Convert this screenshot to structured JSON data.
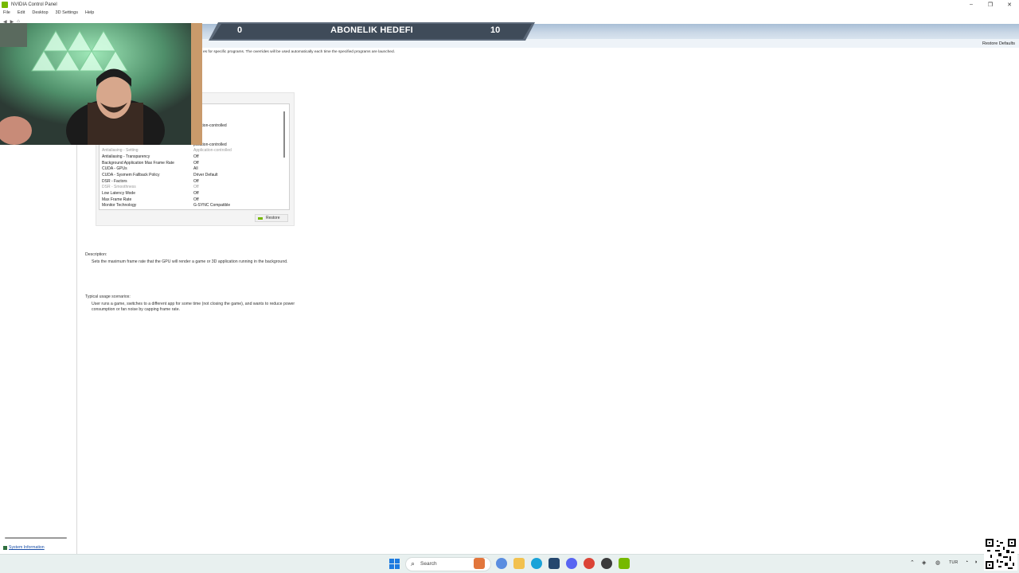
{
  "window": {
    "title": "NVIDIA Control Panel",
    "controls": [
      "–",
      "❐",
      "✕"
    ]
  },
  "menu": [
    "File",
    "Edit",
    "Desktop",
    "3D Settings",
    "Help"
  ],
  "toolbar_icons": [
    "back-icon",
    "forward-icon",
    "home-icon"
  ],
  "header": {
    "restore_defaults": "Restore Defaults"
  },
  "overlay_banner": {
    "left_value": "0",
    "title": "ABONELIK HEDEFI",
    "right_value": "10"
  },
  "content": {
    "intro": "es for specific programs. The overrides will be used automatically each time the specified programs are launched.",
    "settings_rows": [
      {
        "feature": "",
        "value": "d",
        "dim": false
      },
      {
        "feature": "",
        "value": "plication-controlled",
        "dim": false
      },
      {
        "feature": "",
        "value": "plication-controlled",
        "dim": false
      },
      {
        "feature": "Antialiasing - Setting",
        "value": "Application-controlled",
        "dim": true
      },
      {
        "feature": "Antialiasing - Transparency",
        "value": "Off",
        "dim": false
      },
      {
        "feature": "Background Application Max Frame Rate",
        "value": "Off",
        "dim": false
      },
      {
        "feature": "CUDA - GPUs",
        "value": "All",
        "dim": false
      },
      {
        "feature": "CUDA - Sysmem Fallback Policy",
        "value": "Driver Default",
        "dim": false
      },
      {
        "feature": "DSR - Factors",
        "value": "Off",
        "dim": false
      },
      {
        "feature": "DSR - Smoothness",
        "value": "Off",
        "dim": true
      },
      {
        "feature": "Low Latency Mode",
        "value": "Off",
        "dim": false
      },
      {
        "feature": "Max Frame Rate",
        "value": "Off",
        "dim": false
      },
      {
        "feature": "Monitor Technology",
        "value": "G-SYNC Compatible",
        "dim": false
      }
    ],
    "restore_button": "Restore",
    "description_label": "Description:",
    "description_text": "Sets the maximum frame rate that the GPU will render a game or 3D application running in the background.",
    "usage_label": "Typical usage scenarios:",
    "usage_text": "User runs a game, switches to a different app for some time (not closing the game), and wants to reduce power consumption or fan noise by capping frame rate."
  },
  "sidebar": {
    "system_info": "System Information"
  },
  "taskbar": {
    "search_placeholder": "Search",
    "language": "TUR",
    "colors": {
      "start": "#1e7be0",
      "nvidia": "#76b900"
    }
  }
}
